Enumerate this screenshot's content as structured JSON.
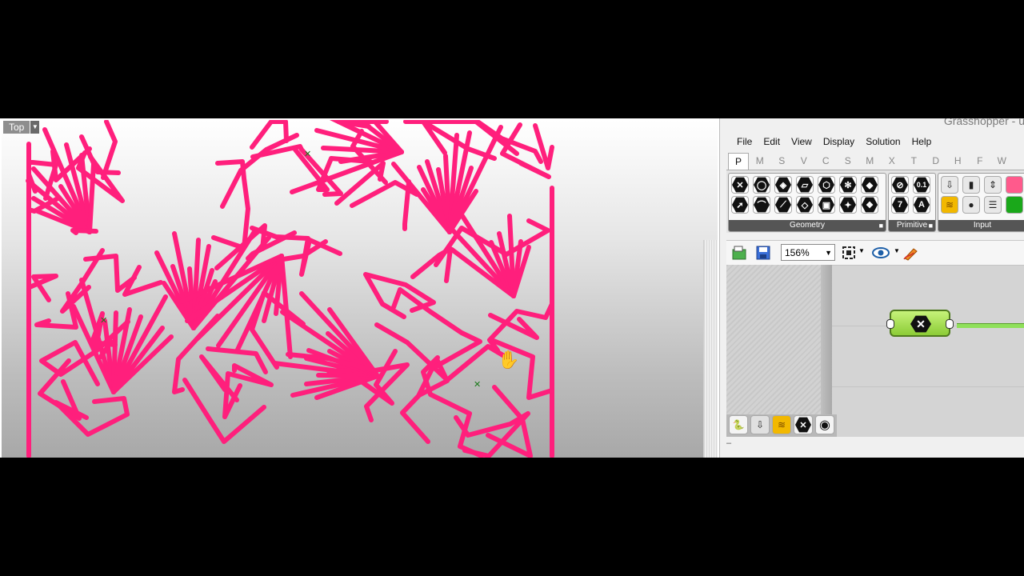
{
  "viewport": {
    "label": "Top",
    "curve_color": "#ff1f7c"
  },
  "grasshopper": {
    "title": "Grasshopper - u",
    "menu": [
      "File",
      "Edit",
      "View",
      "Display",
      "Solution",
      "Help"
    ],
    "tabs": [
      "P",
      "M",
      "S",
      "V",
      "C",
      "S",
      "M",
      "X",
      "T",
      "D",
      "H",
      "F",
      "W"
    ],
    "active_tab": "P",
    "panels": {
      "geometry": "Geometry",
      "primitive": "Primitive",
      "input": "Input"
    },
    "primitive_icons": [
      "0.1",
      "7",
      "A"
    ],
    "zoom": "156%",
    "status": "–",
    "node_color": "#8ccc36"
  }
}
